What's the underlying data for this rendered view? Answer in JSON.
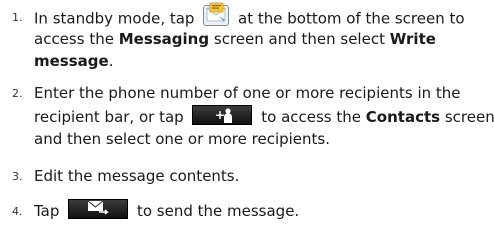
{
  "steps": [
    {
      "number": "1.",
      "line1_a": "In standby mode, tap",
      "line1_b": "at the bottom of the screen to",
      "line2_a": "access the",
      "line2_bold1": "Messaging",
      "line2_b": "screen and then select",
      "line2_bold2": "Write",
      "line3_bold": "message",
      "line3_end": ".",
      "icon": "messaging-icon"
    },
    {
      "number": "2.",
      "line1": "Enter the phone number of one or more recipients in the",
      "line2_a": "recipient bar, or tap",
      "line2_b": "to access the",
      "line2_bold": "Contacts",
      "line2_c": "screen",
      "line3": "and then select one or more recipients.",
      "icon": "add-contact-icon"
    },
    {
      "number": "3.",
      "line1": "Edit the message contents."
    },
    {
      "number": "4.",
      "line1_a": "Tap",
      "line1_b": "to send the message.",
      "icon": "send-icon"
    }
  ],
  "colors": {
    "text": "#1a1a1a",
    "button_bg": "#1e1e1e"
  }
}
